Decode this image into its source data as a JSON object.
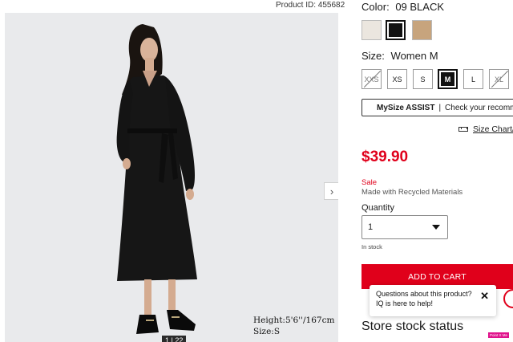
{
  "product_id": "Product ID: 455682",
  "gallery": {
    "counter": "1 | 22",
    "next_icon": "chevron-right-icon",
    "model_height": "Height:5'6''/167cm",
    "model_size": "Size:S"
  },
  "color": {
    "label": "Color:",
    "value": "09 BLACK",
    "swatches": [
      {
        "name": "off-white",
        "hex": "#ebe6df",
        "selected": false
      },
      {
        "name": "black",
        "hex": "#121212",
        "selected": true
      },
      {
        "name": "beige",
        "hex": "#c7a47d",
        "selected": false
      }
    ]
  },
  "size": {
    "label": "Size:",
    "value": "Women M",
    "options": [
      {
        "label": "XXS",
        "available": false,
        "selected": false
      },
      {
        "label": "XS",
        "available": true,
        "selected": false
      },
      {
        "label": "S",
        "available": true,
        "selected": false
      },
      {
        "label": "M",
        "available": true,
        "selected": true
      },
      {
        "label": "L",
        "available": true,
        "selected": false
      },
      {
        "label": "XL",
        "available": false,
        "selected": false
      }
    ]
  },
  "mysize": {
    "brand": "MySize ASSIST",
    "separator": "|",
    "text": "Check your recommended size"
  },
  "size_chart": {
    "icon": "ruler-icon",
    "label": "Size Chart/"
  },
  "price": "$39.90",
  "sale_label": "Sale",
  "material_note": "Made with Recycled Materials",
  "quantity": {
    "label": "Quantity",
    "value": "1"
  },
  "stock_status": "In stock",
  "add_to_cart": "ADD TO CART",
  "chat": {
    "line1": "Questions about this product?",
    "line2": "IQ is here to help!",
    "close": "✕"
  },
  "store_stock_title": "Store stock status",
  "badge": "Point X Me",
  "colors": {
    "accent_red": "#e0001b",
    "gallery_bg": "#e9eaec",
    "badge_pink": "#e0138c"
  }
}
